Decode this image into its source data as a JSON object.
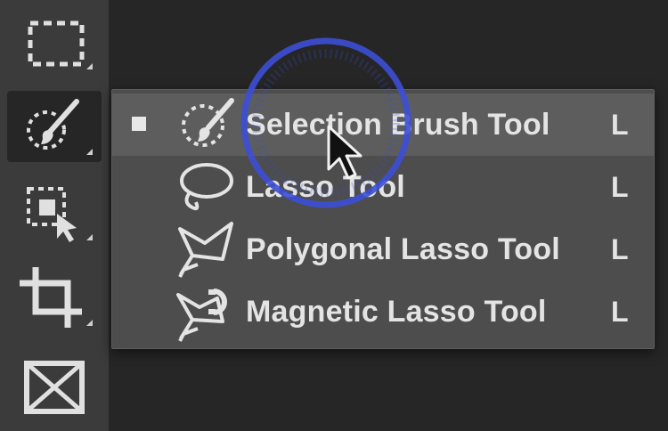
{
  "toolbar": {
    "tools": [
      {
        "name": "Rectangular Marquee Tool",
        "icon": "marquee-icon"
      },
      {
        "name": "Selection Brush Tool",
        "icon": "selection-brush-icon",
        "active": true
      },
      {
        "name": "Object Selection Tool",
        "icon": "object-selection-icon"
      },
      {
        "name": "Crop Tool",
        "icon": "crop-icon"
      },
      {
        "name": "Frame Tool",
        "icon": "frame-icon"
      }
    ]
  },
  "flyout": {
    "items": [
      {
        "label": "Selection Brush Tool",
        "shortcut": "L",
        "icon": "selection-brush-icon",
        "checked": true,
        "highlighted": true
      },
      {
        "label": "Lasso Tool",
        "shortcut": "L",
        "icon": "lasso-icon"
      },
      {
        "label": "Polygonal Lasso Tool",
        "shortcut": "L",
        "icon": "polygonal-lasso-icon"
      },
      {
        "label": "Magnetic Lasso Tool",
        "shortcut": "L",
        "icon": "magnetic-lasso-icon"
      }
    ]
  },
  "colors": {
    "toolbar_bg": "#3b3b3b",
    "menu_bg": "#4d4d4d",
    "highlight_bg": "#5d5d5d",
    "text": "#e4e4e4",
    "focus_ring": "#3d4fd6"
  }
}
